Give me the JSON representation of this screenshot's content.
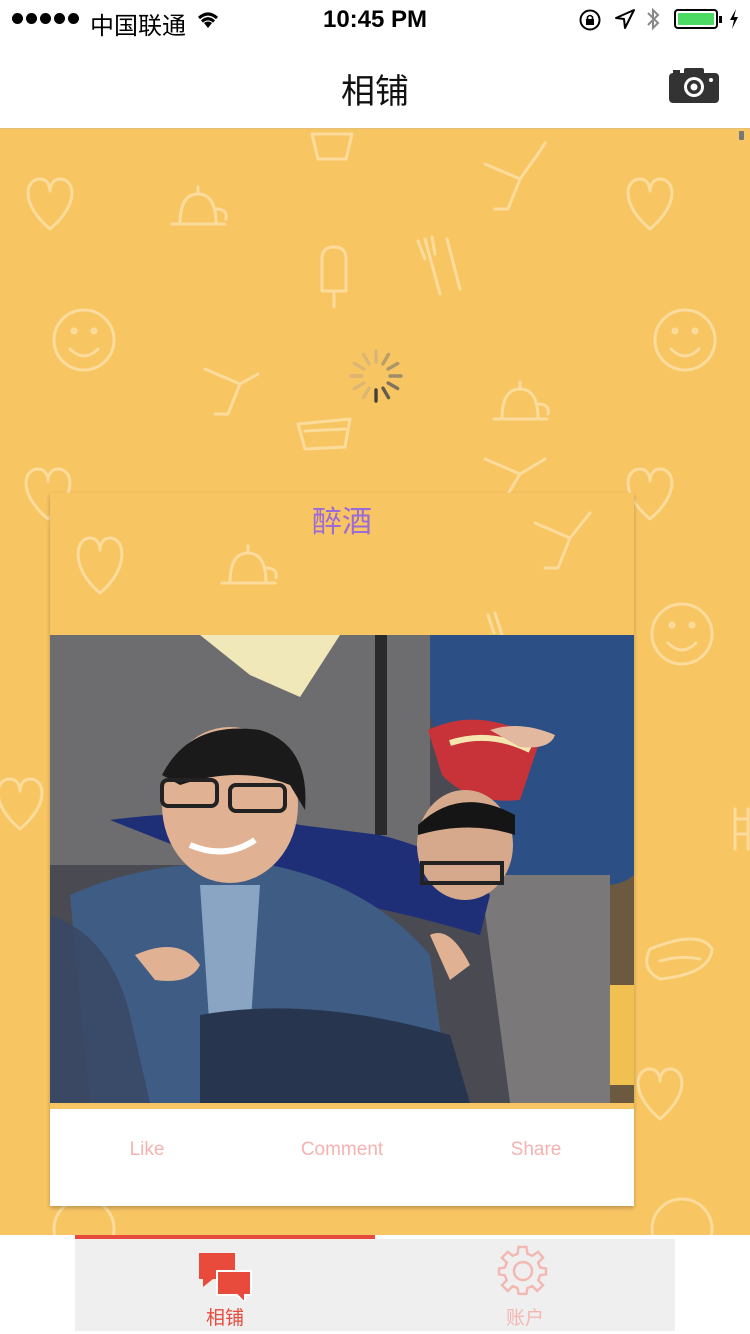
{
  "status_bar": {
    "carrier": "中国联通",
    "time": "10:45 PM"
  },
  "nav": {
    "title": "相铺",
    "camera_icon": "camera-icon"
  },
  "feed": {
    "loading": true,
    "card": {
      "title": "醉酒",
      "actions": {
        "like_label": "Like",
        "comment_label": "Comment",
        "share_label": "Share"
      }
    }
  },
  "tab_bar": {
    "tabs": [
      {
        "label": "相铺",
        "icon": "chat-bubbles-icon",
        "active": true
      },
      {
        "label": "账户",
        "icon": "gear-icon",
        "active": false
      }
    ]
  },
  "colors": {
    "background": "#f8c563",
    "accent": "#e84b3c",
    "card_title": "#9b6bd6",
    "action_text": "#f5b2b0"
  }
}
